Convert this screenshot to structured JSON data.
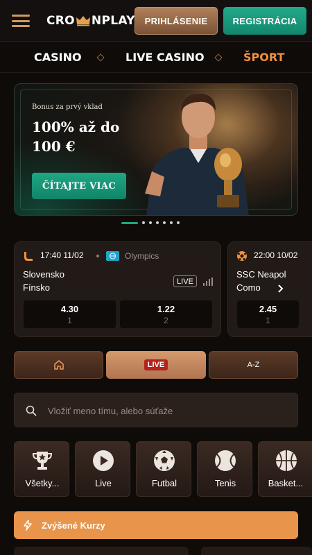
{
  "header": {
    "logo_text_left": "CRO",
    "logo_text_right": "NPLAY",
    "login_label": "PRIHLÁSENIE",
    "register_label": "REGISTRÁCIA"
  },
  "nav": {
    "items": [
      {
        "label": "CASINO"
      },
      {
        "label": "LIVE CASINO"
      },
      {
        "label": "ŠPORT"
      }
    ]
  },
  "banner": {
    "small_text": "Bonus za prvý vklad",
    "headline": "100% až do 100 €",
    "button_label": "ČÍTAJTE VIAC"
  },
  "carousel": {
    "total": 7,
    "active": 1
  },
  "matches": [
    {
      "time": "17:40  11/02",
      "league": "Olympics",
      "home": "Slovensko",
      "away": "Fínsko",
      "live": "LIVE",
      "odds": [
        {
          "value": "4.30",
          "label": "1"
        },
        {
          "value": "1.22",
          "label": "2"
        }
      ]
    },
    {
      "time": "22:00  10/02",
      "home": "SSC Neapol",
      "away": "Como",
      "odds": [
        {
          "value": "2.45",
          "label": "1"
        }
      ]
    }
  ],
  "filters": {
    "live_label": "LIVE",
    "az_label": "A-Z"
  },
  "search": {
    "placeholder": "Vložiť meno tímu, alebo súťaže"
  },
  "sports": [
    {
      "label": "Všetky...",
      "icon": "trophy-icon"
    },
    {
      "label": "Live",
      "icon": "play-icon"
    },
    {
      "label": "Futbal",
      "icon": "soccer-ball-icon"
    },
    {
      "label": "Tenis",
      "icon": "tennis-ball-icon"
    },
    {
      "label": "Basket...",
      "icon": "basketball-icon"
    }
  ],
  "boosted": {
    "label": "Zvýšené Kurzy"
  },
  "colors": {
    "accent_orange": "#f0913f",
    "accent_green": "#1fa783",
    "background": "#0f0b09",
    "card": "#221a17"
  }
}
